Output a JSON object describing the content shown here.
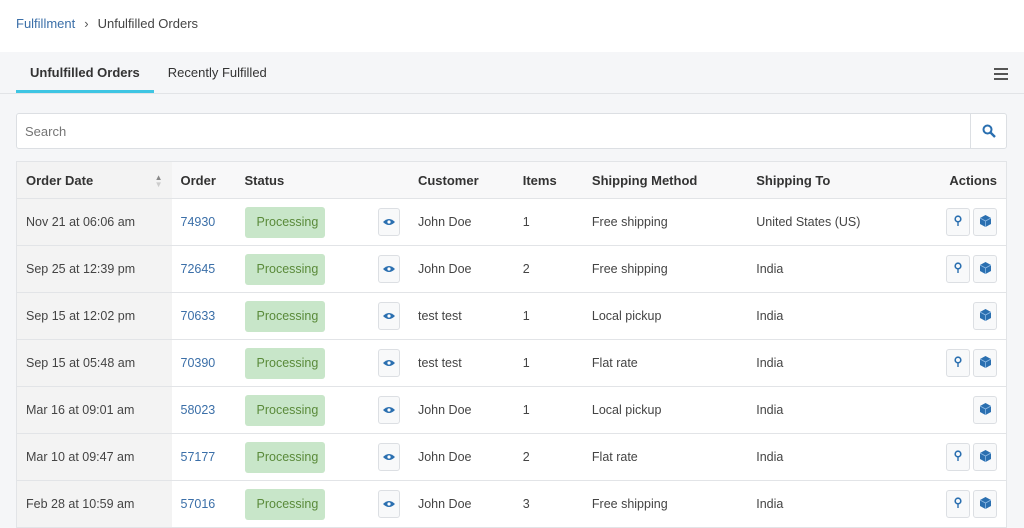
{
  "breadcrumb": {
    "parent": "Fulfillment",
    "current": "Unfulfilled Orders"
  },
  "tabs": [
    {
      "label": "Unfulfilled Orders",
      "active": true
    },
    {
      "label": "Recently Fulfilled",
      "active": false
    }
  ],
  "search": {
    "placeholder": "Search",
    "value": ""
  },
  "table": {
    "headers": [
      "Order Date",
      "Order",
      "Status",
      "Customer",
      "Items",
      "Shipping Method",
      "Shipping To",
      "Actions"
    ],
    "rows": [
      {
        "date": "Nov 21 at 06:06 am",
        "order": "74930",
        "status": "Processing",
        "customer": "John Doe",
        "items": "1",
        "method": "Free shipping",
        "to": "United States (US)",
        "pin": true
      },
      {
        "date": "Sep 25 at 12:39 pm",
        "order": "72645",
        "status": "Processing",
        "customer": "John Doe",
        "items": "2",
        "method": "Free shipping",
        "to": "India",
        "pin": true
      },
      {
        "date": "Sep 15 at 12:02 pm",
        "order": "70633",
        "status": "Processing",
        "customer": "test test",
        "items": "1",
        "method": "Local pickup",
        "to": "India",
        "pin": false
      },
      {
        "date": "Sep 15 at 05:48 am",
        "order": "70390",
        "status": "Processing",
        "customer": "test test",
        "items": "1",
        "method": "Flat rate",
        "to": "India",
        "pin": true
      },
      {
        "date": "Mar 16 at 09:01 am",
        "order": "58023",
        "status": "Processing",
        "customer": "John Doe",
        "items": "1",
        "method": "Local pickup",
        "to": "India",
        "pin": false
      },
      {
        "date": "Mar 10 at 09:47 am",
        "order": "57177",
        "status": "Processing",
        "customer": "John Doe",
        "items": "2",
        "method": "Flat rate",
        "to": "India",
        "pin": true
      },
      {
        "date": "Feb 28 at 10:59 am",
        "order": "57016",
        "status": "Processing",
        "customer": "John Doe",
        "items": "3",
        "method": "Free shipping",
        "to": "India",
        "pin": true
      }
    ]
  },
  "colors": {
    "accent": "#3ec5e3",
    "link": "#3b6fa8",
    "badge_bg": "#c8e6c9",
    "icon": "#2a6fb0"
  }
}
